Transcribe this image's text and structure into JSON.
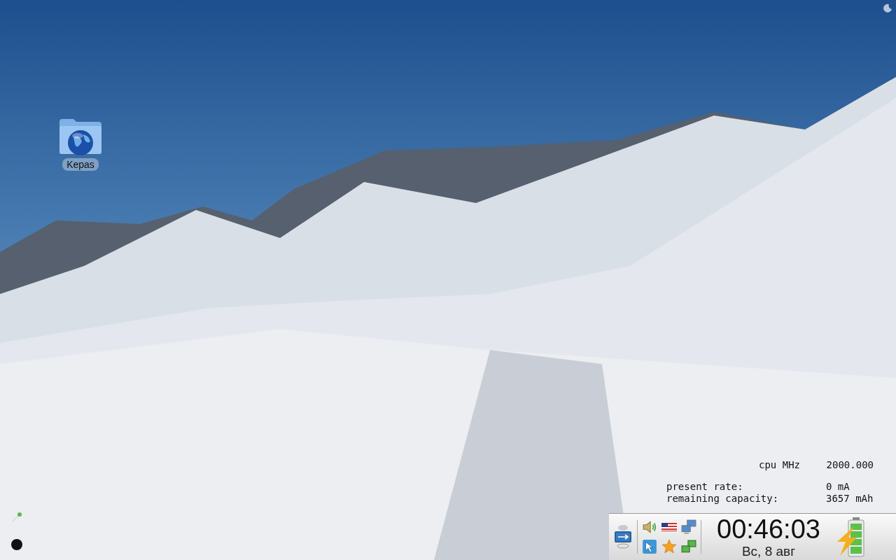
{
  "desktop_icons": [
    {
      "label": "Kepas"
    }
  ],
  "conky": {
    "cpu": {
      "label": "cpu MHz",
      "value": "2000.000"
    },
    "battery": [
      {
        "label": "present rate:",
        "value": "0 mA"
      },
      {
        "label": "remaining capacity:",
        "value": "3657 mAh"
      }
    ]
  },
  "panel": {
    "clock": {
      "time": "00:46:03",
      "date": "Вс, 8 авг"
    }
  }
}
